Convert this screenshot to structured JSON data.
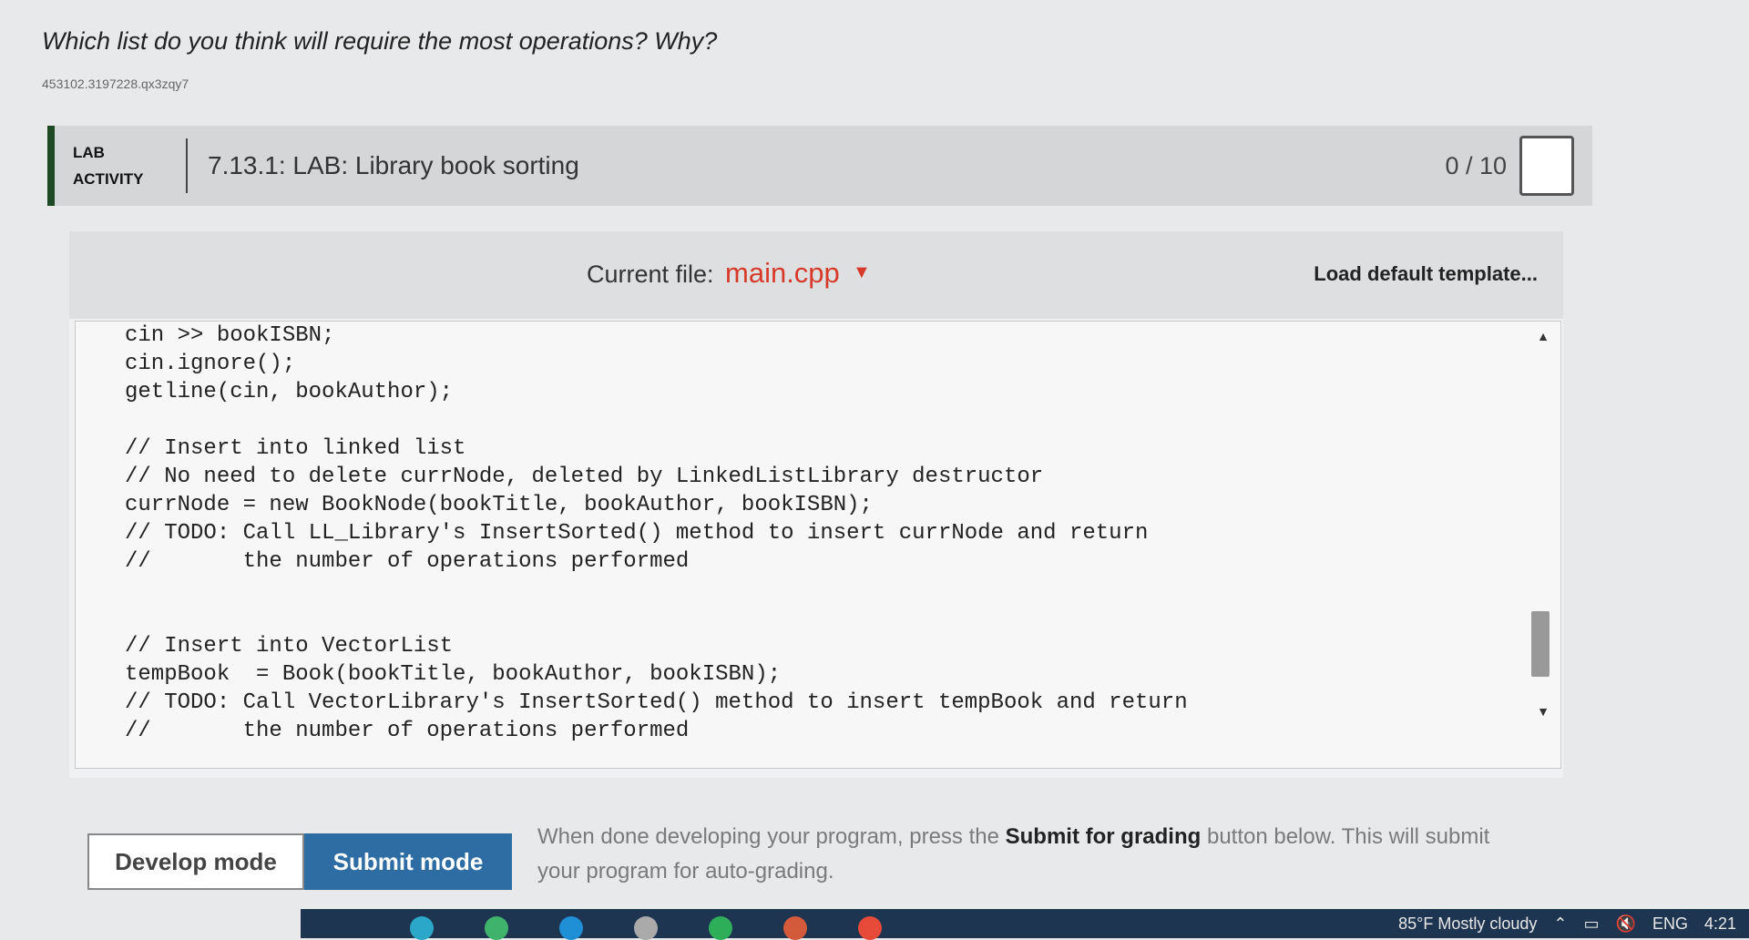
{
  "question": "Which list do you think will require the most operations? Why?",
  "question_id": "453102.3197228.qx3zqy7",
  "lab": {
    "tag_line1": "LAB",
    "tag_line2": "ACTIVITY",
    "title": "7.13.1: LAB: Library book sorting",
    "score": "0 / 10"
  },
  "editor": {
    "current_file_label": "Current file:",
    "current_file": "main.cpp",
    "load_template": "Load default template...",
    "code": "cin >> bookISBN;\ncin.ignore();\ngetline(cin, bookAuthor);\n\n// Insert into linked list\n// No need to delete currNode, deleted by LinkedListLibrary destructor\ncurrNode = new BookNode(bookTitle, bookAuthor, bookISBN);\n// TODO: Call LL_Library's InsertSorted() method to insert currNode and return\n//       the number of operations performed\n\n\n// Insert into VectorList\ntempBook  = Book(bookTitle, bookAuthor, bookISBN);\n// TODO: Call VectorLibrary's InsertSorted() method to insert tempBook and return\n//       the number of operations performed"
  },
  "modes": {
    "develop": "Develop mode",
    "submit": "Submit mode",
    "desc_before": "When done developing your program, press the ",
    "desc_bold": "Submit for grading",
    "desc_after": " button below. This will submit your program for auto-grading."
  },
  "taskbar": {
    "weather": "85°F  Mostly cloudy",
    "lang": "ENG",
    "time": "4:21"
  },
  "colors": {
    "accent_file": "#d83a2a",
    "submit_btn": "#2e6da4",
    "lab_bar": "#1d4a24"
  }
}
